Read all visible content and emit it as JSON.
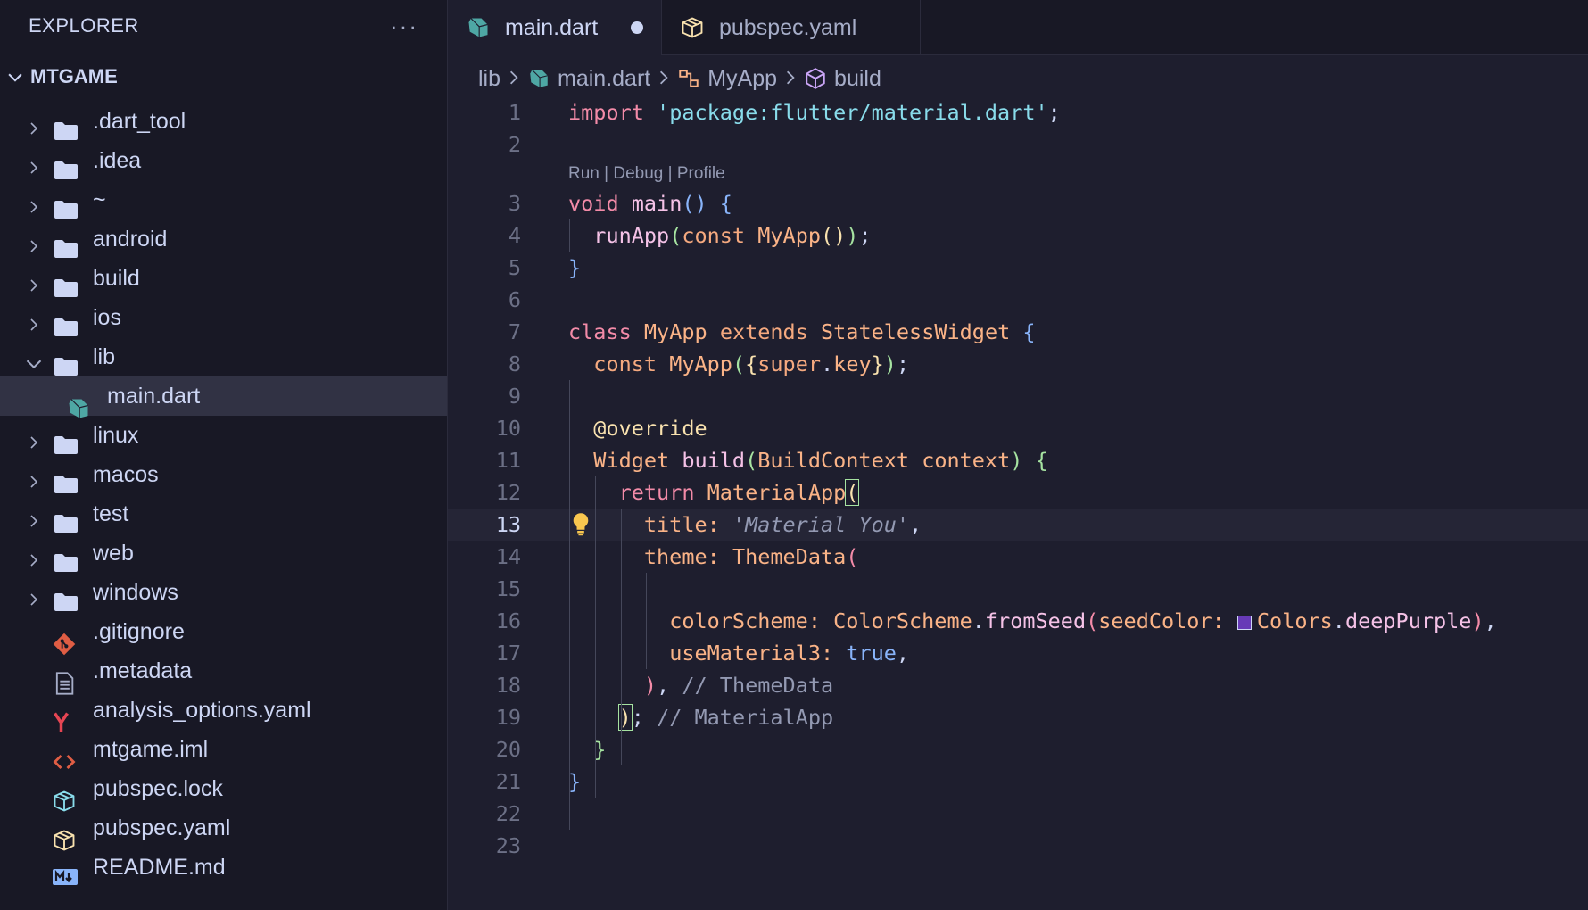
{
  "sidebar": {
    "title": "EXPLORER",
    "more_label": "···",
    "root": "MTGAME",
    "items": [
      {
        "label": ".dart_tool",
        "kind": "folder"
      },
      {
        "label": ".idea",
        "kind": "folder"
      },
      {
        "label": "~",
        "kind": "folder"
      },
      {
        "label": "android",
        "kind": "folder"
      },
      {
        "label": "build",
        "kind": "folder"
      },
      {
        "label": "ios",
        "kind": "folder"
      },
      {
        "label": "lib",
        "kind": "folder-open"
      },
      {
        "label": "main.dart",
        "kind": "dart-file"
      },
      {
        "label": "linux",
        "kind": "folder"
      },
      {
        "label": "macos",
        "kind": "folder"
      },
      {
        "label": "test",
        "kind": "folder"
      },
      {
        "label": "web",
        "kind": "folder"
      },
      {
        "label": "windows",
        "kind": "folder"
      },
      {
        "label": ".gitignore",
        "kind": "git-file"
      },
      {
        "label": ".metadata",
        "kind": "text-file"
      },
      {
        "label": "analysis_options.yaml",
        "kind": "yaml-file"
      },
      {
        "label": "mtgame.iml",
        "kind": "xml-file"
      },
      {
        "label": "pubspec.lock",
        "kind": "lock-file"
      },
      {
        "label": "pubspec.yaml",
        "kind": "package-file"
      },
      {
        "label": "README.md",
        "kind": "markdown-file"
      }
    ]
  },
  "tabs": [
    {
      "label": "main.dart",
      "active": true,
      "dirty": true
    },
    {
      "label": "pubspec.yaml",
      "active": false,
      "dirty": false
    }
  ],
  "breadcrumb": {
    "lib": "lib",
    "file": "main.dart",
    "class": "MyApp",
    "method": "build"
  },
  "codelens": {
    "run": "Run",
    "debug": "Debug",
    "profile": "Profile",
    "sep": " | "
  },
  "editor": {
    "current_line": 13,
    "line_numbers": [
      "1",
      "2",
      "3",
      "4",
      "5",
      "6",
      "7",
      "8",
      "9",
      "10",
      "11",
      "12",
      "13",
      "14",
      "15",
      "16",
      "17",
      "18",
      "19",
      "20",
      "21",
      "22",
      "23"
    ],
    "code": {
      "import_kw": "import",
      "import_str": "'package:flutter/material.dart'",
      "semi": ";",
      "void_kw": "void",
      "main_fn": "main",
      "runapp_fn": "runApp",
      "const_kw": "const",
      "myapp": "MyApp",
      "class_kw": "class",
      "extends_kw": "extends",
      "stateless": "StatelessWidget",
      "super_key": "super",
      "key": "key",
      "override": "@override",
      "widget": "Widget",
      "build_fn": "build",
      "buildcontext": "BuildContext",
      "context": "context",
      "return_kw": "return",
      "materialapp": "MaterialApp",
      "title_prop": "title:",
      "title_val": "Material You",
      "theme_prop": "theme:",
      "themedata": "ThemeData",
      "colorscheme_prop": "colorScheme:",
      "colorscheme_cls": "ColorScheme",
      "fromseed_fn": "fromSeed",
      "seedcolor_prop": "seedColor:",
      "colors_cls": "Colors",
      "deeppurple": "deepPurple",
      "usematerial3_prop": "useMaterial3:",
      "true_val": "true",
      "comment_themedata": "// ThemeData",
      "comment_materialapp": "// MaterialApp"
    }
  },
  "colors": {
    "sidebar_bg": "#181825",
    "editor_bg": "#1e1e2e",
    "selected_bg": "#313244",
    "seed_color_swatch": "#673ab7"
  }
}
